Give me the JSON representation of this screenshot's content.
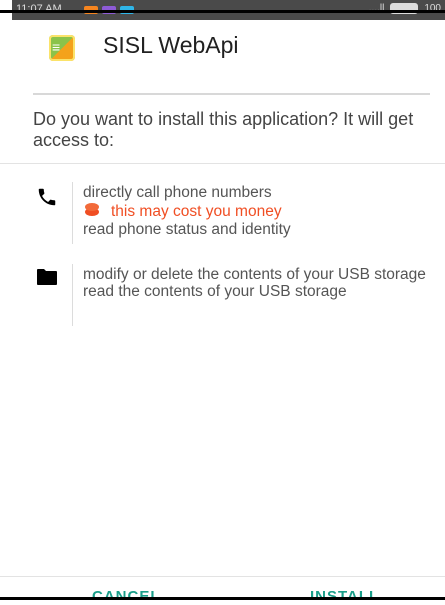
{
  "status_bar": {
    "time": "11:07 AM",
    "notification_colors": [
      "#f6851f",
      "#8e5bd6",
      "#2fb5e8"
    ],
    "signal": "....ll",
    "battery_label": "100"
  },
  "app": {
    "name": "SISL WebApi",
    "icon": "app-icon"
  },
  "prompt": "Do you want to install this application? It will get access to:",
  "permissions": [
    {
      "icon": "phone-icon",
      "lines": [
        "directly call phone numbers",
        "read phone status and identity"
      ],
      "warning": "this may cost you money"
    },
    {
      "icon": "folder-icon",
      "lines": [
        "modify or delete the contents of your USB storage",
        "read the contents of your USB storage"
      ]
    }
  ],
  "buttons": {
    "cancel": "CANCEL",
    "install": "INSTALL"
  },
  "colors": {
    "accent": "#1a9e8a",
    "warning": "#f04e23"
  }
}
